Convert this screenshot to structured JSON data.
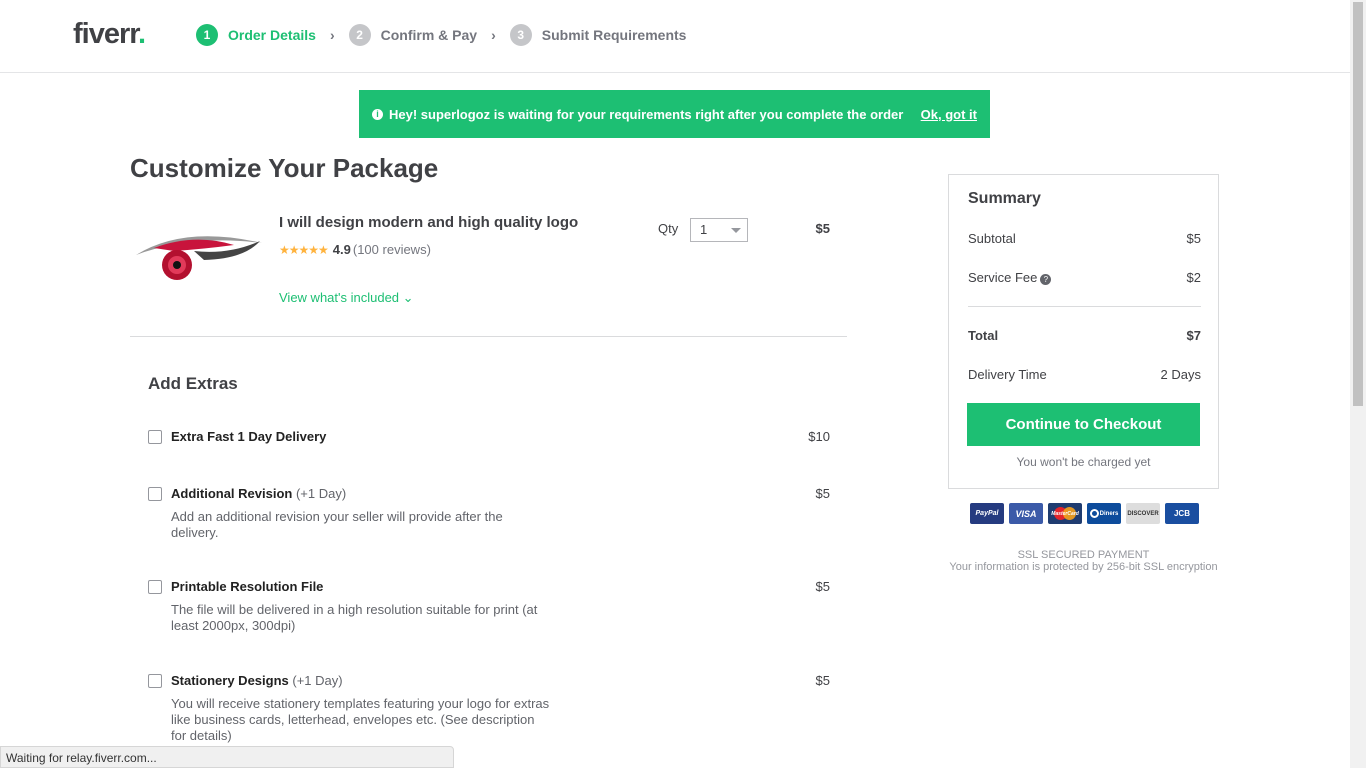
{
  "header": {
    "logo": "fiverr",
    "logo_dot": ".",
    "steps": [
      {
        "num": "1",
        "label": "Order Details",
        "active": true
      },
      {
        "num": "2",
        "label": "Confirm & Pay"
      },
      {
        "num": "3",
        "label": "Submit Requirements"
      }
    ]
  },
  "banner": {
    "message": "Hey! superlogoz is waiting for your requirements right after you complete the order",
    "dismiss": "Ok, got it",
    "color": "#1dbf73"
  },
  "page_title": "Customize Your Package",
  "gig": {
    "title": "I will design modern and high quality logo",
    "stars": "★★★★★",
    "rating": "4.9",
    "reviews": "(100 reviews)",
    "included_link": "View what's included",
    "qty_label": "Qty",
    "qty_value": "1",
    "price": "$5"
  },
  "extras": {
    "title": "Add Extras",
    "items": [
      {
        "title": "Extra Fast 1 Day Delivery",
        "suffix": "",
        "desc": "",
        "price": "$10"
      },
      {
        "title": "Additional Revision",
        "suffix": "(+1 Day)",
        "desc": "Add an additional revision your seller will provide after the delivery.",
        "price": "$5"
      },
      {
        "title": "Printable Resolution File",
        "suffix": "",
        "desc": "The file will be delivered in a high resolution suitable for print (at least 2000px, 300dpi)",
        "price": "$5"
      },
      {
        "title": "Stationery Designs",
        "suffix": "(+1 Day)",
        "desc": "You will receive stationery templates featuring your logo for extras like business cards, letterhead, envelopes etc. (See description for details)",
        "price": "$5"
      }
    ]
  },
  "summary": {
    "title": "Summary",
    "subtotal_label": "Subtotal",
    "subtotal": "$5",
    "fee_label": "Service Fee",
    "fee": "$2",
    "total_label": "Total",
    "total": "$7",
    "delivery_label": "Delivery Time",
    "delivery": "2 Days",
    "checkout": "Continue to Checkout",
    "note": "You won't be charged yet"
  },
  "payment": {
    "cards": [
      "PayPal",
      "VISA",
      "MasterCard",
      "Diners",
      "DISCOVER",
      "JCB"
    ],
    "ssl_title": "SSL SECURED PAYMENT",
    "ssl_desc": "Your information is protected by 256-bit SSL encryption"
  },
  "status_bar": "Waiting for relay.fiverr.com..."
}
